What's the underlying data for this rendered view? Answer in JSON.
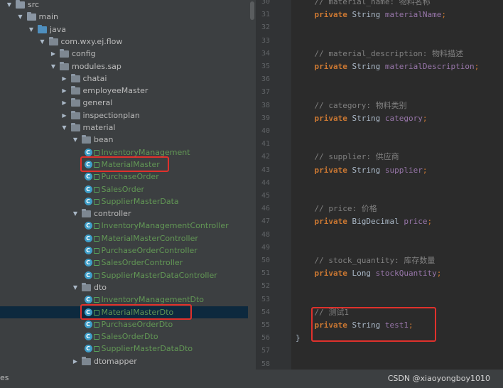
{
  "project_tree": [
    {
      "label": "src",
      "icon": "folder",
      "arrow": "open",
      "depth": 0,
      "color": "#bbbbbb"
    },
    {
      "label": "main",
      "icon": "folder",
      "arrow": "open",
      "depth": 1
    },
    {
      "label": "java",
      "icon": "source-folder",
      "arrow": "open",
      "depth": 2
    },
    {
      "label": "com.wxy.ej.flow",
      "icon": "package",
      "arrow": "open",
      "depth": 3
    },
    {
      "label": "config",
      "icon": "package",
      "arrow": "closed",
      "depth": 4
    },
    {
      "label": "modules.sap",
      "icon": "package",
      "arrow": "open",
      "depth": 4
    },
    {
      "label": "chatai",
      "icon": "package",
      "arrow": "closed",
      "depth": 5
    },
    {
      "label": "employeeMaster",
      "icon": "package",
      "arrow": "closed",
      "depth": 5
    },
    {
      "label": "general",
      "icon": "package",
      "arrow": "closed",
      "depth": 5
    },
    {
      "label": "inspectionplan",
      "icon": "package",
      "arrow": "closed",
      "depth": 5
    },
    {
      "label": "material",
      "icon": "package",
      "arrow": "open",
      "depth": 5
    },
    {
      "label": "bean",
      "icon": "package",
      "arrow": "open",
      "depth": 6
    },
    {
      "label": "InventoryManagement",
      "icon": "class",
      "depth": 7
    },
    {
      "label": "MaterialMaster",
      "icon": "class",
      "depth": 7,
      "highlight": true
    },
    {
      "label": "PurchaseOrder",
      "icon": "class",
      "depth": 7
    },
    {
      "label": "SalesOrder",
      "icon": "class",
      "depth": 7
    },
    {
      "label": "SupplierMasterData",
      "icon": "class",
      "depth": 7
    },
    {
      "label": "controller",
      "icon": "package",
      "arrow": "open",
      "depth": 6
    },
    {
      "label": "InventoryManagementController",
      "icon": "class",
      "depth": 7
    },
    {
      "label": "MaterialMasterController",
      "icon": "class",
      "depth": 7
    },
    {
      "label": "PurchaseOrderController",
      "icon": "class",
      "depth": 7
    },
    {
      "label": "SalesOrderController",
      "icon": "class",
      "depth": 7
    },
    {
      "label": "SupplierMasterDataController",
      "icon": "class",
      "depth": 7
    },
    {
      "label": "dto",
      "icon": "package",
      "arrow": "open",
      "depth": 6
    },
    {
      "label": "InventoryManagementDto",
      "icon": "class",
      "depth": 7
    },
    {
      "label": "MaterialMasterDto",
      "icon": "class",
      "depth": 7,
      "highlight": true,
      "selected": true
    },
    {
      "label": "PurchaseOrderDto",
      "icon": "class",
      "depth": 7
    },
    {
      "label": "SalesOrderDto",
      "icon": "class",
      "depth": 7
    },
    {
      "label": "SupplierMasterDataDto",
      "icon": "class",
      "depth": 7
    },
    {
      "label": "dtomapper",
      "icon": "package",
      "arrow": "closed",
      "depth": 6
    }
  ],
  "editor": {
    "lines": [
      {
        "n": "30",
        "parts": [
          {
            "t": "    // material_name: 物料名称",
            "c": "cmt"
          }
        ]
      },
      {
        "n": "31",
        "parts": [
          {
            "t": "    ",
            "c": "type"
          },
          {
            "t": "private",
            "c": "kw"
          },
          {
            "t": " String ",
            "c": "type"
          },
          {
            "t": "materialName",
            "c": "field"
          },
          {
            "t": ";",
            "c": "semi"
          }
        ]
      },
      {
        "n": "32",
        "parts": []
      },
      {
        "n": "33",
        "parts": []
      },
      {
        "n": "34",
        "parts": [
          {
            "t": "    // material_description: 物料描述",
            "c": "cmt"
          }
        ]
      },
      {
        "n": "35",
        "parts": [
          {
            "t": "    ",
            "c": "type"
          },
          {
            "t": "private",
            "c": "kw"
          },
          {
            "t": " String ",
            "c": "type"
          },
          {
            "t": "materialDescription",
            "c": "field"
          },
          {
            "t": ";",
            "c": "semi"
          }
        ]
      },
      {
        "n": "36",
        "parts": []
      },
      {
        "n": "37",
        "parts": []
      },
      {
        "n": "38",
        "parts": [
          {
            "t": "    // category: 物料类别",
            "c": "cmt"
          }
        ]
      },
      {
        "n": "39",
        "parts": [
          {
            "t": "    ",
            "c": "type"
          },
          {
            "t": "private",
            "c": "kw"
          },
          {
            "t": " String ",
            "c": "type"
          },
          {
            "t": "category",
            "c": "field"
          },
          {
            "t": ";",
            "c": "semi"
          }
        ]
      },
      {
        "n": "40",
        "parts": []
      },
      {
        "n": "41",
        "parts": []
      },
      {
        "n": "42",
        "parts": [
          {
            "t": "    // supplier: 供应商",
            "c": "cmt"
          }
        ]
      },
      {
        "n": "43",
        "parts": [
          {
            "t": "    ",
            "c": "type"
          },
          {
            "t": "private",
            "c": "kw"
          },
          {
            "t": " String ",
            "c": "type"
          },
          {
            "t": "supplier",
            "c": "field"
          },
          {
            "t": ";",
            "c": "semi"
          }
        ]
      },
      {
        "n": "44",
        "parts": []
      },
      {
        "n": "45",
        "parts": []
      },
      {
        "n": "46",
        "parts": [
          {
            "t": "    // price: 价格",
            "c": "cmt"
          }
        ]
      },
      {
        "n": "47",
        "parts": [
          {
            "t": "    ",
            "c": "type"
          },
          {
            "t": "private",
            "c": "kw"
          },
          {
            "t": " BigDecimal ",
            "c": "type"
          },
          {
            "t": "price",
            "c": "field"
          },
          {
            "t": ";",
            "c": "semi"
          }
        ]
      },
      {
        "n": "48",
        "parts": []
      },
      {
        "n": "49",
        "parts": []
      },
      {
        "n": "50",
        "parts": [
          {
            "t": "    // stock_quantity: 库存数量",
            "c": "cmt"
          }
        ]
      },
      {
        "n": "51",
        "parts": [
          {
            "t": "    ",
            "c": "type"
          },
          {
            "t": "private",
            "c": "kw"
          },
          {
            "t": " Long ",
            "c": "type"
          },
          {
            "t": "stockQuantity",
            "c": "field"
          },
          {
            "t": ";",
            "c": "semi"
          }
        ]
      },
      {
        "n": "52",
        "parts": []
      },
      {
        "n": "53",
        "parts": []
      },
      {
        "n": "54",
        "parts": [
          {
            "t": "    // 测试1",
            "c": "cmt"
          }
        ]
      },
      {
        "n": "55",
        "parts": [
          {
            "t": "    ",
            "c": "type"
          },
          {
            "t": "private",
            "c": "kw"
          },
          {
            "t": " String ",
            "c": "type"
          },
          {
            "t": "test1",
            "c": "field"
          },
          {
            "t": ";",
            "c": "semi"
          }
        ]
      },
      {
        "n": "56",
        "parts": [
          {
            "t": "}",
            "c": "brace"
          }
        ]
      },
      {
        "n": "57",
        "parts": []
      },
      {
        "n": "58",
        "parts": []
      }
    ],
    "highlighted_lines": [
      "54",
      "55"
    ]
  },
  "status_bar": {
    "left_text": "es",
    "watermark": "CSDN @xiaoyongboy1010"
  },
  "colors": {
    "highlight_border": "#e0312c",
    "class_name": "#629755",
    "keyword": "#cc7832",
    "field": "#9876aa",
    "comment": "#808080"
  }
}
